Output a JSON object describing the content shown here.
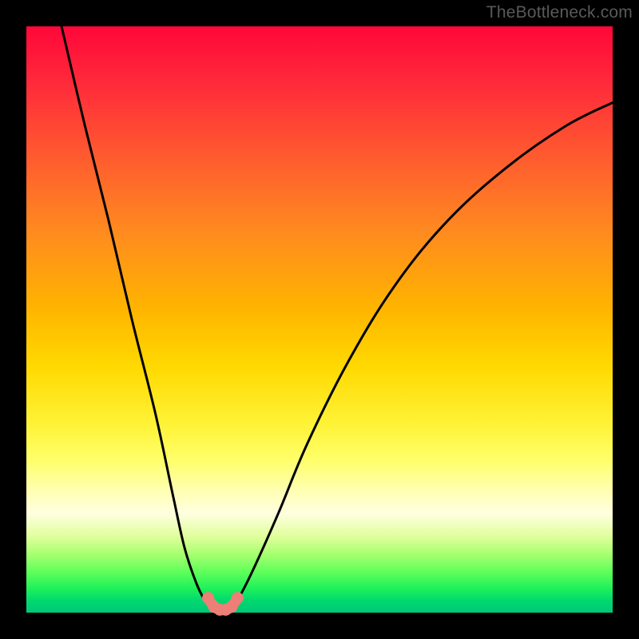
{
  "watermark": "TheBottleneck.com",
  "colors": {
    "frame": "#000000",
    "curve": "#000000",
    "dot_fill": "#ed7f78",
    "dot_stroke": "#c95b54"
  },
  "chart_data": {
    "type": "line",
    "title": "",
    "xlabel": "",
    "ylabel": "",
    "xlim": [
      0,
      100
    ],
    "ylim": [
      0,
      100
    ],
    "grid": false,
    "legend": false,
    "note": "V-shaped bottleneck curve over rainbow gradient; axes are unlabeled in the image, values are estimated as % of plot area.",
    "series": [
      {
        "name": "left-branch",
        "x": [
          6,
          10,
          14,
          18,
          22,
          25,
          27,
          29,
          30.5,
          31.5
        ],
        "y": [
          100,
          83,
          67,
          50,
          34,
          20,
          11,
          5,
          2,
          1
        ]
      },
      {
        "name": "right-branch",
        "x": [
          35,
          36.5,
          39,
          43,
          48,
          55,
          63,
          72,
          82,
          92,
          100
        ],
        "y": [
          1,
          3,
          8,
          17,
          29,
          43,
          56,
          67,
          76,
          83,
          87
        ]
      },
      {
        "name": "valley-dots",
        "x": [
          31,
          32,
          33,
          34,
          35,
          36
        ],
        "y": [
          2.5,
          1.0,
          0.5,
          0.5,
          1.0,
          2.5
        ]
      }
    ]
  }
}
